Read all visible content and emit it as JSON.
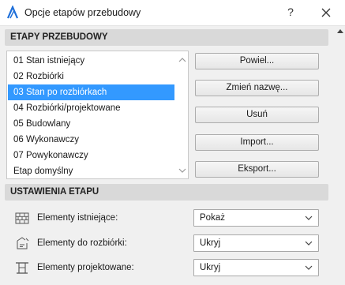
{
  "window": {
    "title": "Opcje etapów przebudowy",
    "help_label": "?"
  },
  "icons": {
    "app": "archicad-logo-icon",
    "close": "close-icon",
    "existing": "brick-wall-icon",
    "demolish": "demolition-icon",
    "new": "new-construction-icon"
  },
  "phases_section": {
    "header": "ETAPY PRZEBUDOWY",
    "items": [
      {
        "label": "01 Stan istniejący"
      },
      {
        "label": "02 Rozbiórki"
      },
      {
        "label": "03 Stan po rozbiórkach"
      },
      {
        "label": "04 Rozbiórki/projektowane"
      },
      {
        "label": "05 Budowlany"
      },
      {
        "label": "06 Wykonawczy"
      },
      {
        "label": "07 Powykonawczy"
      },
      {
        "label": "Etap domyślny"
      }
    ],
    "selected_label": "03 Stan po rozbiórkach",
    "buttons": {
      "duplicate": "Powiel...",
      "rename": "Zmień nazwę...",
      "delete": "Usuń",
      "import": "Import...",
      "export": "Eksport..."
    }
  },
  "settings_section": {
    "header": "USTAWIENIA ETAPU",
    "rows": [
      {
        "label": "Elementy istniejące:",
        "value": "Pokaż"
      },
      {
        "label": "Elementy do rozbiórki:",
        "value": "Ukryj"
      },
      {
        "label": "Elementy projektowane:",
        "value": "Ukryj"
      }
    ]
  },
  "colors": {
    "selection": "#3399ff",
    "section_header": "#d9d9d9",
    "logo": "#1e6fd9"
  }
}
